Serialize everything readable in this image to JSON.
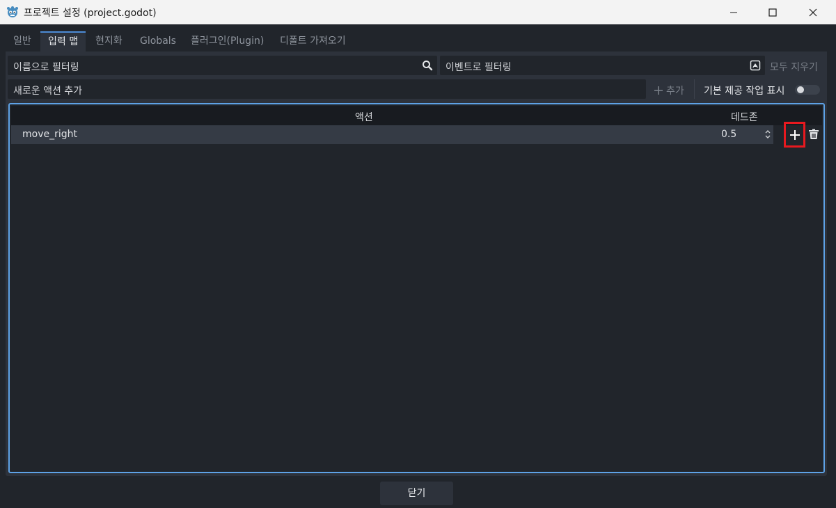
{
  "window": {
    "title": "프로젝트 설정 (project.godot)",
    "minimize_icon": "minimize-icon",
    "maximize_icon": "maximize-icon",
    "close_icon": "close-icon"
  },
  "tabs": [
    {
      "label": "일반"
    },
    {
      "label": "입력 맵",
      "active": true
    },
    {
      "label": "현지화"
    },
    {
      "label": "Globals"
    },
    {
      "label": "플러그인(Plugin)"
    },
    {
      "label": "디폴트 가져오기"
    }
  ],
  "filters": {
    "name_filter": "이름으로 필터링",
    "event_filter": "이벤트로 필터링",
    "clear_all": "모두 지우기"
  },
  "new_action": {
    "placeholder": "새로운 액션 추가",
    "add_label": "추가",
    "show_builtin_label": "기본 제공 작업 표시",
    "show_builtin_on": false
  },
  "table": {
    "col_action": "액션",
    "col_deadzone": "데드존",
    "rows": [
      {
        "action": "move_right",
        "deadzone": "0.5"
      }
    ]
  },
  "footer": {
    "close_label": "닫기"
  },
  "colors": {
    "accent": "#5ea2e6",
    "highlight": "#e8191f"
  }
}
